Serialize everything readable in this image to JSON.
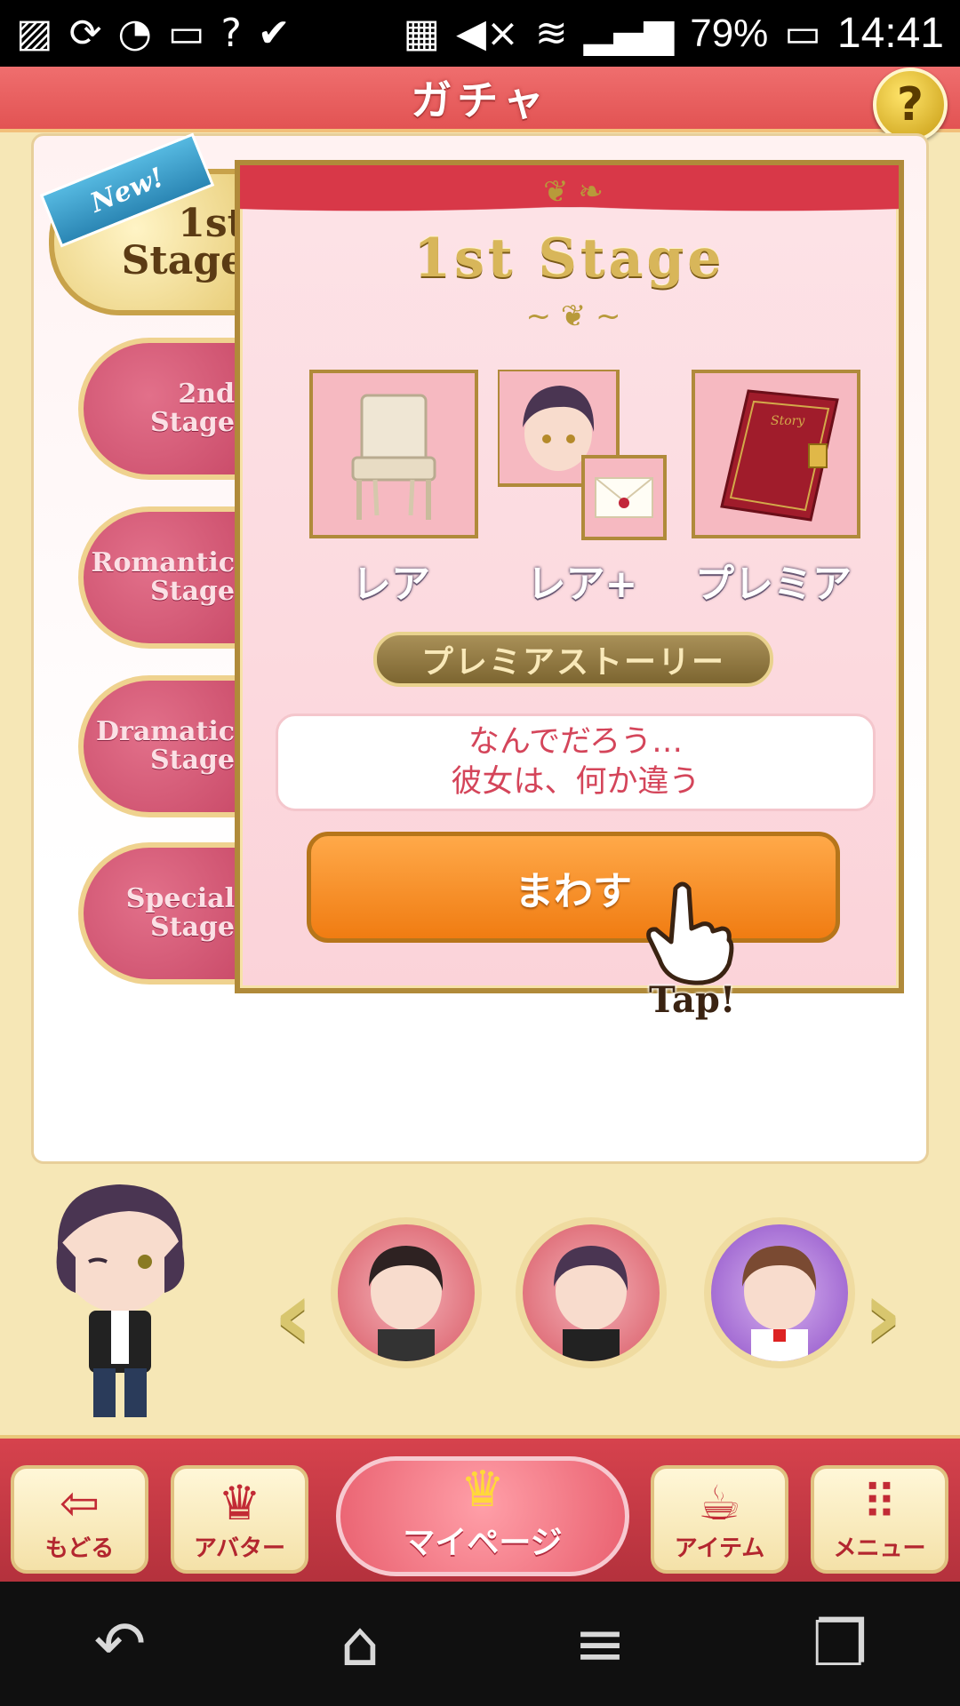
{
  "status_bar": {
    "battery_percent": "79%",
    "time": "14:41"
  },
  "header": {
    "title": "ガチャ",
    "help_label": "?"
  },
  "stage_tabs": [
    {
      "id": "1st",
      "label_line1": "1st",
      "label_line2": "Stage",
      "active": true,
      "badge": "New!"
    },
    {
      "id": "2nd",
      "label_line1": "2nd",
      "label_line2": "Stage",
      "active": false
    },
    {
      "id": "romantic",
      "label_line1": "Romantic",
      "label_line2": "Stage",
      "active": false
    },
    {
      "id": "dramatic",
      "label_line1": "Dramatic",
      "label_line2": "Stage",
      "active": false
    },
    {
      "id": "special",
      "label_line1": "Special",
      "label_line2": "Stage",
      "active": false
    }
  ],
  "stage": {
    "title": "1st Stage",
    "prizes": [
      {
        "label": "レア",
        "icon": "chair-icon"
      },
      {
        "label": "レア+",
        "icon": "character-letter-icon"
      },
      {
        "label": "プレミア",
        "icon": "story-book-icon"
      }
    ],
    "category": "プレミアストーリー",
    "description_line1": "なんでだろう…",
    "description_line2": "彼女は、何か違う",
    "spin_button": "まわす",
    "tap_hint": "Tap!"
  },
  "characters": {
    "carousel": [
      "character-1",
      "character-2",
      "character-3"
    ]
  },
  "bottom_nav": {
    "back": "もどる",
    "avatar": "アバター",
    "mypage": "マイページ",
    "item": "アイテム",
    "menu": "メニュー"
  },
  "colors": {
    "header_red": "#e25353",
    "tab_pink": "#c94a68",
    "spin_orange": "#f07c12",
    "desc_text": "#d4455a"
  }
}
